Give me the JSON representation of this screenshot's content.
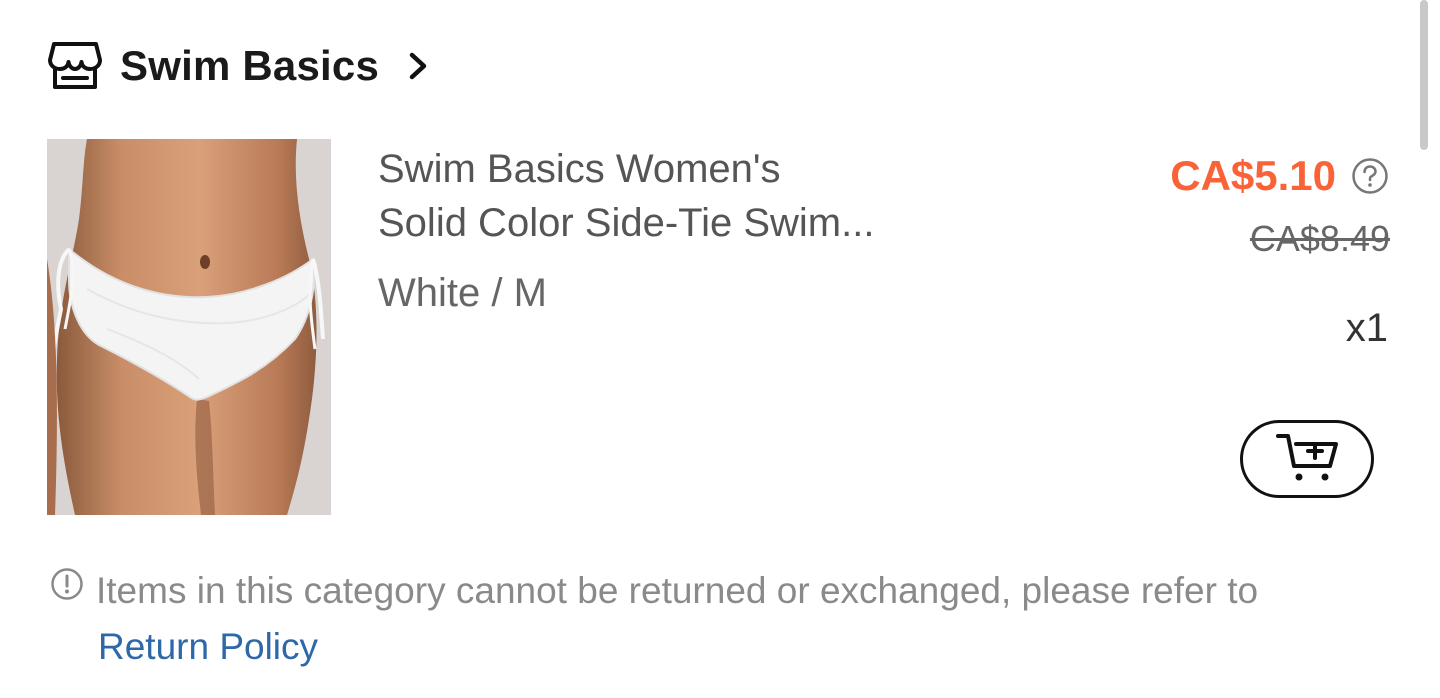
{
  "store": {
    "name": "Swim Basics"
  },
  "product": {
    "title_line1": "Swim Basics Women's",
    "title_line2": "Solid Color Side-Tie Swim...",
    "variant": "White / M",
    "price_current": "CA$5.10",
    "price_original": "CA$8.49",
    "quantity": "x1"
  },
  "notice": {
    "text": "Items in this category cannot be returned or exchanged, please refer to",
    "link_label": "Return Policy"
  },
  "colors": {
    "price_accent": "#fa6338",
    "link": "#2d68a8"
  },
  "icons": {
    "store": "store-icon",
    "chevron": "chevron-right-icon",
    "help": "help-circle-icon",
    "add_to_cart": "cart-plus-icon",
    "notice": "info-circle-icon"
  }
}
